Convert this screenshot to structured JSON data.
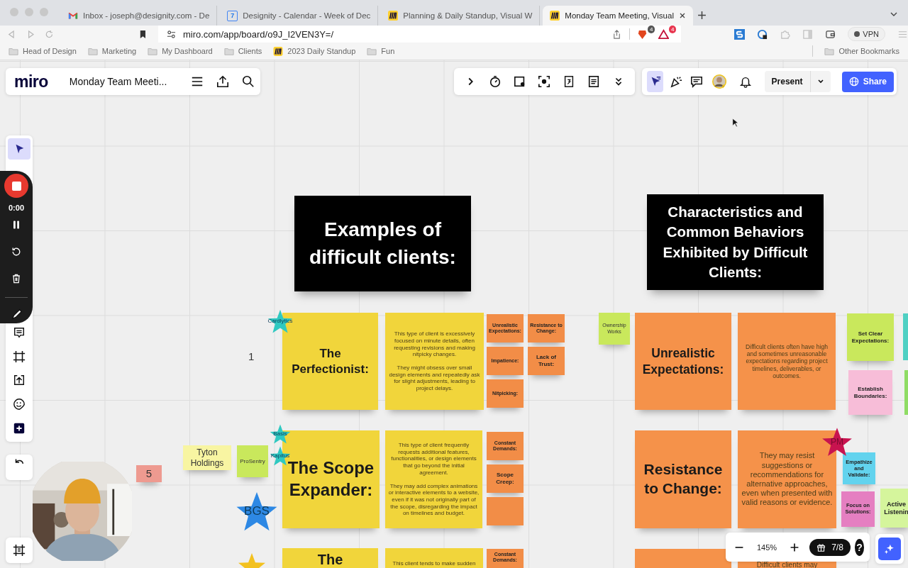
{
  "browser": {
    "tabs": [
      {
        "kind": "mail",
        "title": "Inbox - joseph@designity.com - De",
        "selected": false
      },
      {
        "kind": "calendar",
        "favicon_text": "7",
        "title": "Designity - Calendar - Week of Dec",
        "selected": false
      },
      {
        "kind": "board",
        "title": "Planning & Daily Standup, Visual W",
        "selected": false
      },
      {
        "kind": "board",
        "title": "Monday Team Meeting, Visual",
        "selected": true
      }
    ],
    "address": "miro.com/app/board/o9J_I2VEN3Y=/",
    "extension_badges": [
      "4",
      "4"
    ],
    "vpn": "VPN",
    "bookmarks": [
      {
        "kind": "folder",
        "label": "Head of Design"
      },
      {
        "kind": "folder",
        "label": "Marketing"
      },
      {
        "kind": "folder",
        "label": "My Dashboard"
      },
      {
        "kind": "folder",
        "label": "Clients"
      },
      {
        "kind": "board",
        "label": "2023 Daily Standup"
      },
      {
        "kind": "folder",
        "label": "Fun"
      }
    ],
    "other_bookmarks": "Other Bookmarks"
  },
  "board": {
    "logo": "miro",
    "title": "Monday Team Meeti...",
    "top_tools": [
      {
        "selected": true
      },
      {
        "selected": false
      },
      {
        "selected": false
      }
    ],
    "present": "Present",
    "share": "Share",
    "left_tools": [
      {
        "selected": true
      },
      {
        "selected": false
      },
      {
        "selected": false
      },
      {
        "selected": false
      },
      {
        "selected": false
      },
      {
        "selected": false
      }
    ],
    "recorder": {
      "time": "0:00"
    },
    "zoom": "145%",
    "pages": "7/8",
    "help": "?"
  },
  "canvas": {
    "headers": [
      {
        "text": "Examples of difficult clients:"
      },
      {
        "text": "Characteristics and Common Behaviors Exhibited by Difficult Clients:"
      }
    ],
    "stickies": [
      {
        "kind": "title",
        "color": "#f1d53b",
        "text": "The Perfectionist:"
      },
      {
        "kind": "body",
        "color": "#f1d53b",
        "text": "This type of client is excessively focused on minute details, often requesting revisions and making nitpicky changes.\n\nThey might obsess over small design elements and repeatedly ask for slight adjustments, leading to project delays."
      },
      {
        "kind": "title",
        "color": "#f1d53b",
        "text": "The Scope Expander:"
      },
      {
        "kind": "body",
        "color": "#f1d53b",
        "text": "This type of client frequently requests additional features, functionalities, or design elements that go beyond the initial agreement.\n\nThey may add complex animations or interactive elements to a website, even if it was not originally part of the scope, disregarding the impact on timelines and budget."
      },
      {
        "kind": "title",
        "color": "#f1d53b",
        "text": "The"
      },
      {
        "kind": "body",
        "color": "#f1d53b",
        "text": "This client tends to make sudden"
      },
      {
        "kind": "label",
        "color": "#f28d47",
        "text": "Unrealistic Expectations:"
      },
      {
        "kind": "label",
        "color": "#f28d47",
        "text": "Resistance to Change:"
      },
      {
        "kind": "label",
        "color": "#f28d47",
        "text": "Impatience:"
      },
      {
        "kind": "label",
        "color": "#f28d47",
        "text": "Lack of Trust:"
      },
      {
        "kind": "label",
        "color": "#f28d47",
        "text": "Nitpicking:"
      },
      {
        "kind": "label",
        "color": "#f28d47",
        "text": "Constant Demands:"
      },
      {
        "kind": "label",
        "color": "#f28d47",
        "text": "Scope Creep:"
      },
      {
        "kind": "label",
        "color": "#f28d47"
      },
      {
        "kind": "label",
        "color": "#f28d47",
        "text": "Constant Demands:"
      },
      {
        "kind": "note",
        "color": "#c9e85c",
        "text": "Ownership Works"
      },
      {
        "kind": "note",
        "color": "#f8f5a2",
        "text": "Tyton Holdings"
      },
      {
        "kind": "note",
        "color": "#c9e85c",
        "text": "ProSentry"
      },
      {
        "kind": "note",
        "color": "#ee9a90",
        "text": "5"
      },
      {
        "kind": "title",
        "color": "#f5924a",
        "text": "Unrealistic Expectations:"
      },
      {
        "kind": "body",
        "color": "#f5924a",
        "text": "Difficult clients often have high and sometimes unreasonable expectations regarding project timelines, deliverables, or outcomes."
      },
      {
        "kind": "title",
        "color": "#f5924a",
        "text": "Resistance to Change:"
      },
      {
        "kind": "body",
        "color": "#f5924a",
        "text": "They may resist suggestions or recommendations for alternative approaches, even when presented with valid reasons or evidence."
      },
      {
        "kind": "title",
        "color": "#f5924a"
      },
      {
        "kind": "body",
        "color": "#f5924a",
        "text": "Difficult clients may"
      },
      {
        "kind": "label",
        "color": "#c9e85c",
        "text": "Set Clear Expectations:"
      },
      {
        "kind": "label",
        "color": "#4fd0c3"
      },
      {
        "kind": "label",
        "color": "#f7bdd8",
        "text": "Establish Boundaries:"
      },
      {
        "kind": "label",
        "color": "#8fdc64"
      },
      {
        "kind": "label",
        "color": "#62d3ee",
        "text": "Empathize and Validate:"
      },
      {
        "kind": "label",
        "color": "#e57fc1",
        "text": "Focus on Solutions:"
      },
      {
        "kind": "label",
        "color": "#d5f59c",
        "text": "Active Listenin"
      }
    ],
    "stars": [
      {
        "label": "Cardlytics",
        "color": "#2fc9c1"
      },
      {
        "label": "Basis",
        "color": "#2fc9c1"
      },
      {
        "label": "Kapitus",
        "color": "#2fc9c1"
      },
      {
        "label": "BGS",
        "color": "#2d88e4"
      },
      {
        "color": "#f3c11f"
      },
      {
        "label": "PM",
        "color": "#c8134f"
      }
    ],
    "texts": [
      "1"
    ]
  }
}
